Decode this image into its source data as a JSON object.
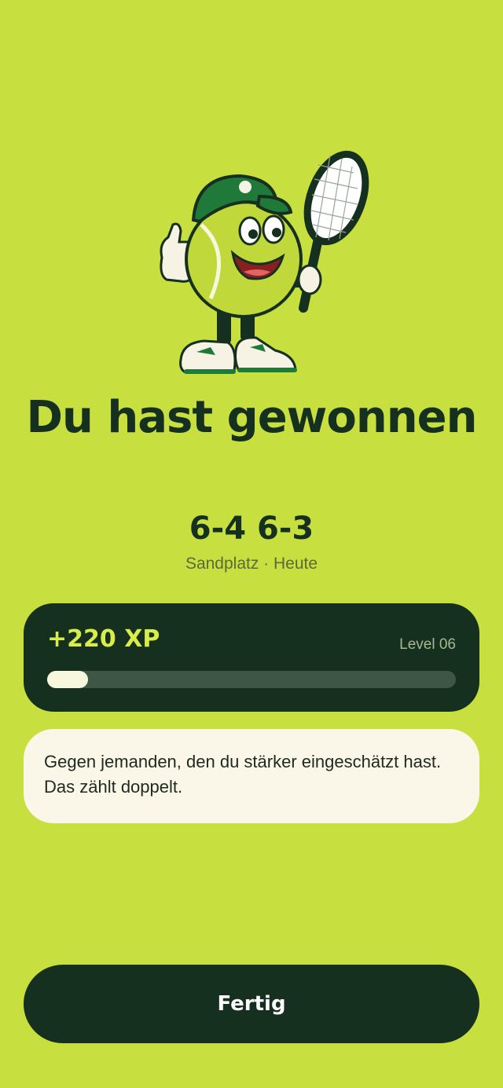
{
  "result": {
    "title": "Du hast gewonnen",
    "score": "6-4 6-3",
    "meta": "Sandplatz · Heute"
  },
  "xp": {
    "gained": "+220 XP",
    "level": "Level 06",
    "progress": 0.1
  },
  "message": "Gegen jemanden, den du stärker eingeschätzt hast. Das zählt doppelt.",
  "actions": {
    "done_label": "Fertig"
  },
  "mascot": {
    "icon": "tennis-ball-mascot-icon",
    "description_icons": [
      "tennis-racket-icon",
      "cap-icon",
      "thumbs-up-icon"
    ]
  },
  "colors": {
    "background": "#c8e03f",
    "dark": "#163020",
    "accent": "#d8ec4a",
    "card_light": "#faf6e8"
  }
}
